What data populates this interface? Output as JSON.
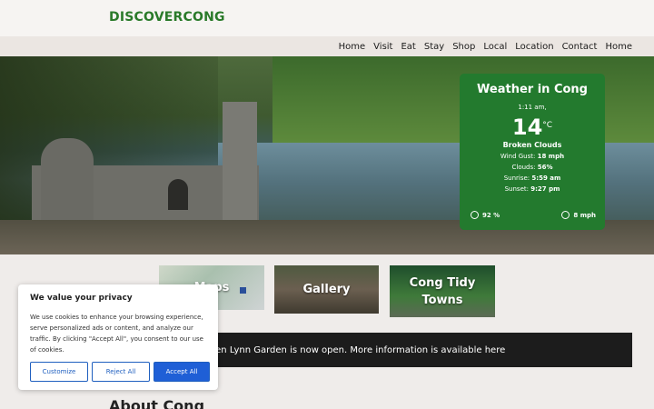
{
  "site": {
    "logo": "DISCOVERCONG"
  },
  "nav": {
    "items": [
      "Home",
      "Visit",
      "Eat",
      "Stay",
      "Shop",
      "Local",
      "Location",
      "Contact",
      "Home"
    ]
  },
  "weather": {
    "title": "Weather in Cong",
    "time": "1:11 am,",
    "temp": "14",
    "unit": "°C",
    "condition": "Broken Clouds",
    "wind_label": "Wind Gust:",
    "wind_value": "18 mph",
    "clouds_label": "Clouds:",
    "clouds_value": "56%",
    "sunrise_label": "Sunrise:",
    "sunrise_value": "5:59 am",
    "sunset_label": "Sunset:",
    "sunset_value": "9:27 pm",
    "humidity": "92 %",
    "wind_speed": "8 mph"
  },
  "tiles": [
    {
      "label": "Maps"
    },
    {
      "label": "Gallery"
    },
    {
      "label": "Cong Tidy Towns"
    }
  ],
  "banner": {
    "text": "een Lynn Garden is now open. More information is available here"
  },
  "about": {
    "title": "About Cong"
  },
  "cookie": {
    "title": "We value your privacy",
    "text": "We use cookies to enhance your browsing experience, serve personalized ads or content, and analyze our traffic. By clicking \"Accept All\", you consent to our use of cookies.",
    "customize": "Customize",
    "reject": "Reject All",
    "accept": "Accept All"
  },
  "colors": {
    "brand_green": "#2a7a2a",
    "weather_bg": "#237a2e",
    "accept_blue": "#1f5fd6"
  }
}
